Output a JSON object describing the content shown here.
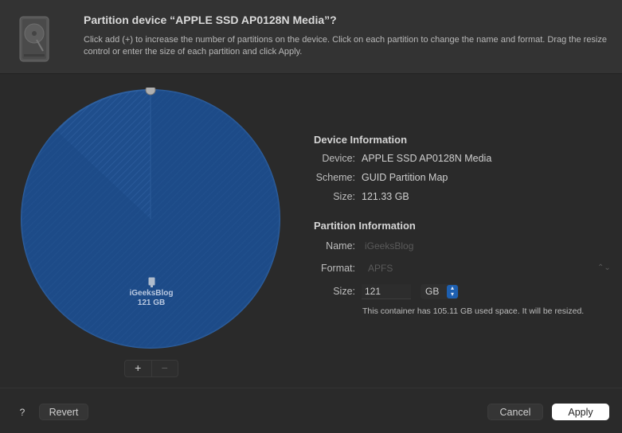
{
  "header": {
    "title": "Partition device “APPLE SSD AP0128N Media”?",
    "description": "Click add (+) to increase the number of partitions on the device. Click on each partition to change the name and format. Drag the resize control or enter the size of each partition and click Apply.",
    "icon": "hard-disk-icon"
  },
  "pie": {
    "partition_name": "iGeeksBlog",
    "partition_size": "121 GB",
    "add_label": "+",
    "remove_label": "−",
    "used_fraction": 0.87,
    "fill_color": "#1f4e8c"
  },
  "device_info": {
    "title": "Device Information",
    "device_label": "Device:",
    "device_value": "APPLE SSD AP0128N Media",
    "scheme_label": "Scheme:",
    "scheme_value": "GUID Partition Map",
    "size_label": "Size:",
    "size_value": "121.33 GB"
  },
  "partition_info": {
    "title": "Partition Information",
    "name_label": "Name:",
    "name_value": "iGeeksBlog",
    "format_label": "Format:",
    "format_value": "APFS",
    "size_label": "Size:",
    "size_value": "121",
    "unit_value": "GB",
    "note": "This container has 105.11 GB used space. It will be resized."
  },
  "footer": {
    "help_label": "?",
    "revert_label": "Revert",
    "cancel_label": "Cancel",
    "apply_label": "Apply"
  }
}
